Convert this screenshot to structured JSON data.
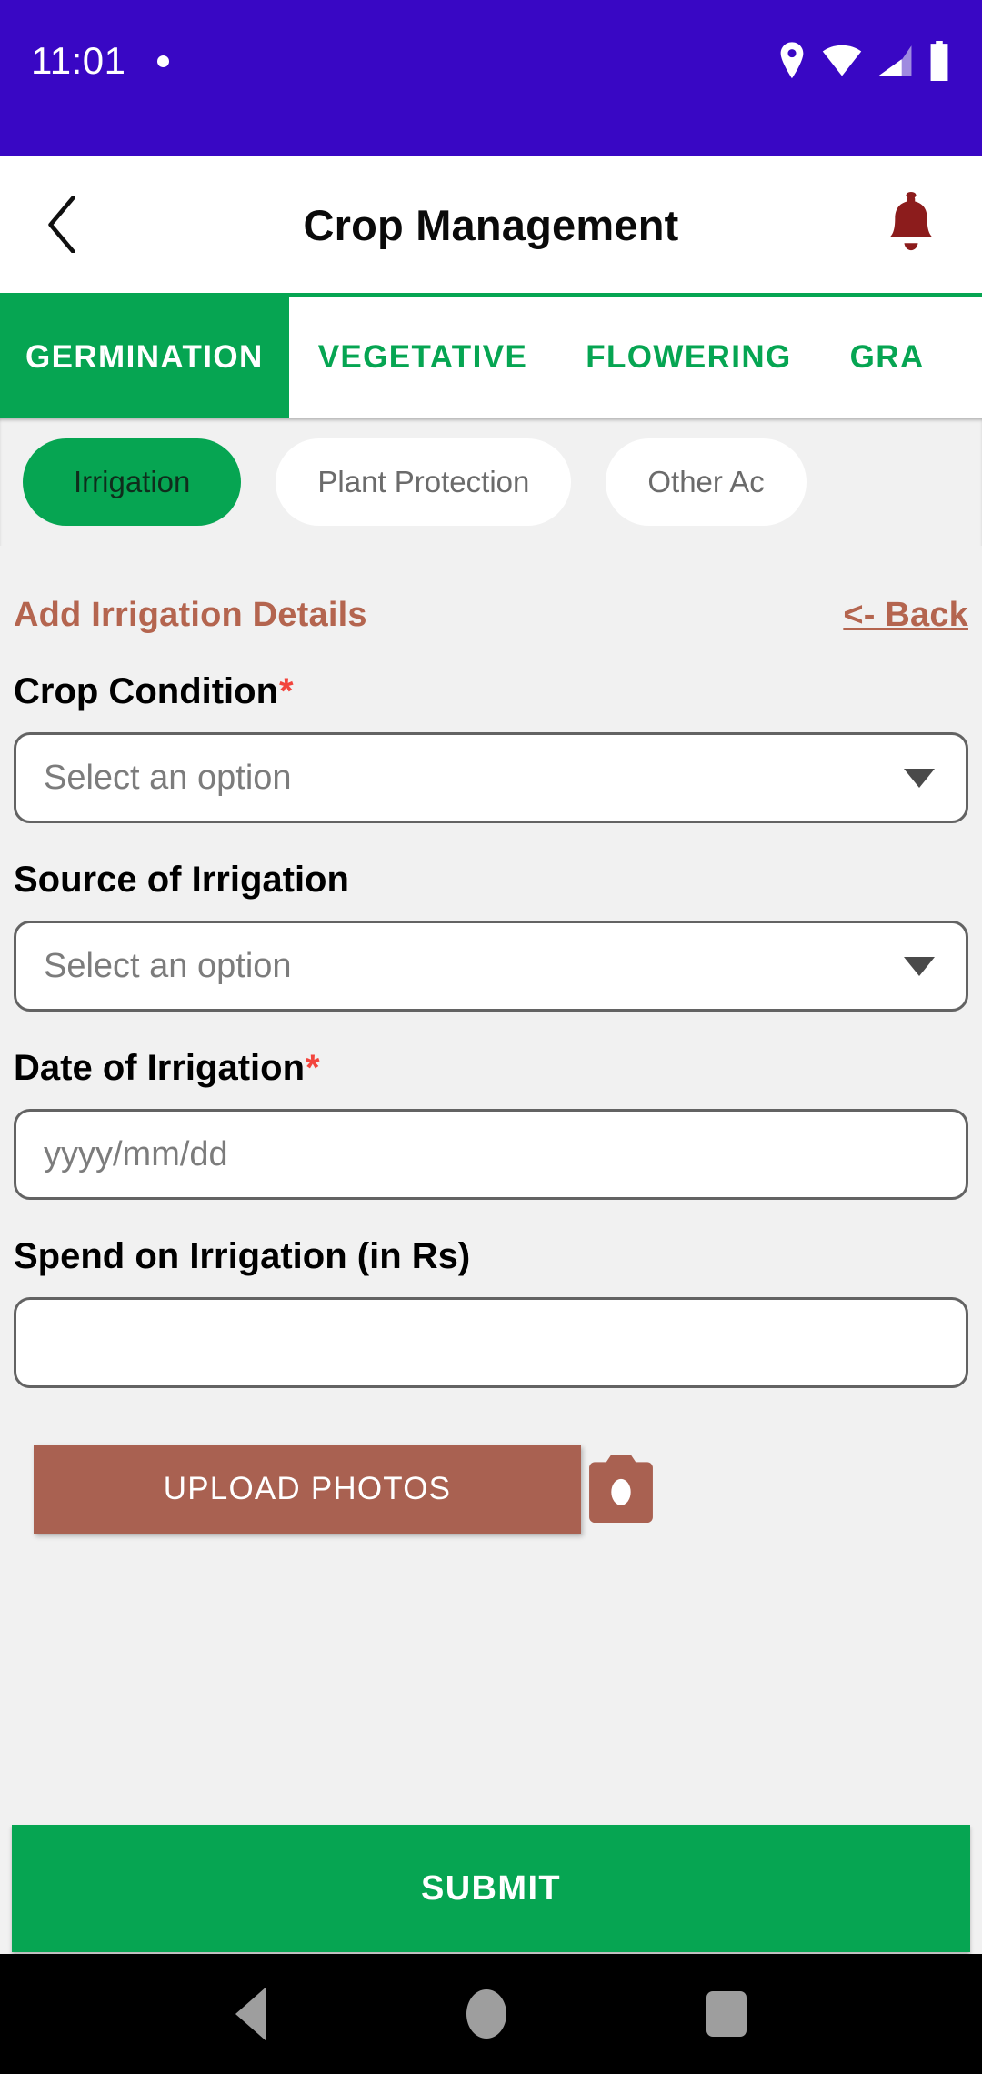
{
  "status_bar": {
    "time": "11:01",
    "icons": [
      "dot-indicator",
      "location-pin-icon",
      "wifi-icon",
      "cellular-signal-icon",
      "battery-icon"
    ],
    "background": "#3907c4"
  },
  "app_bar": {
    "back_label": "‹",
    "title": "Crop Management",
    "notification_icon": "bell-icon",
    "notification_color": "#8c1c1c"
  },
  "tabs": {
    "items": [
      {
        "label": "GERMINATION",
        "active": true
      },
      {
        "label": "VEGETATIVE",
        "active": false
      },
      {
        "label": "FLOWERING",
        "active": false
      },
      {
        "label": "GRA",
        "active": false
      }
    ],
    "accent": "#06a552"
  },
  "chips": {
    "items": [
      {
        "label": "Irrigation",
        "active": true
      },
      {
        "label": "Plant Protection",
        "active": false
      },
      {
        "label": "Other Ac",
        "active": false
      }
    ]
  },
  "form": {
    "section_title": "Add Irrigation Details",
    "back_link": "<- Back",
    "accent": "#b4654f",
    "required_marker": "*",
    "fields": [
      {
        "label": "Crop Condition",
        "required": true,
        "type": "select",
        "value": "",
        "placeholder": "Select an option",
        "caret_icon": "chevron-down-icon"
      },
      {
        "label": "Source of Irrigation",
        "required": false,
        "type": "select",
        "value": "",
        "placeholder": "Select an option",
        "caret_icon": "chevron-down-icon"
      },
      {
        "label": "Date of Irrigation",
        "required": true,
        "type": "date",
        "value": "",
        "placeholder": "yyyy/mm/dd"
      },
      {
        "label": "Spend on Irrigation (in Rs)",
        "required": false,
        "type": "number",
        "value": "",
        "placeholder": ""
      }
    ],
    "upload_label": "UPLOAD PHOTOS",
    "upload_color": "#a96151",
    "camera_icon": "camera-icon",
    "submit_label": "SUBMIT",
    "submit_color": "#06a552"
  },
  "nav_bar": {
    "items": [
      "back-triangle-icon",
      "home-circle-icon",
      "recents-square-icon"
    ]
  }
}
